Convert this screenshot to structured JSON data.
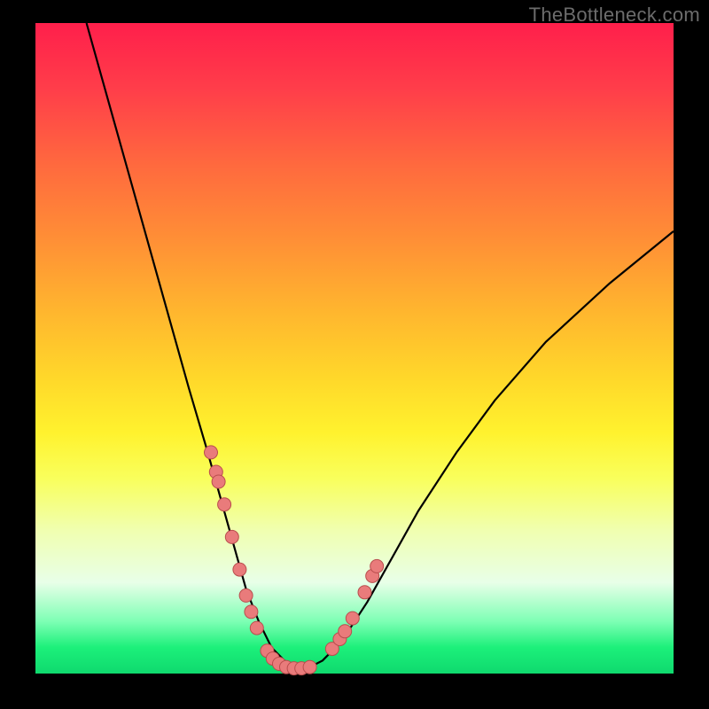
{
  "watermark": "TheBottleneck.com",
  "colors": {
    "background": "#000000",
    "curve": "#000000",
    "dot_fill": "#e97b7b",
    "dot_stroke": "#b94d4d"
  },
  "chart_data": {
    "type": "line",
    "title": "",
    "xlabel": "",
    "ylabel": "",
    "xlim": [
      0,
      100
    ],
    "ylim": [
      0,
      100
    ],
    "grid": false,
    "legend": false,
    "series": [
      {
        "name": "bottleneck-curve",
        "x": [
          8,
          12,
          16,
          20,
          24,
          27,
          29,
          31,
          33,
          35,
          37,
          39,
          41,
          43,
          45,
          48,
          52,
          56,
          60,
          66,
          72,
          80,
          90,
          100
        ],
        "y": [
          100,
          86,
          72,
          58,
          44,
          34,
          27,
          20,
          13,
          8,
          4,
          2,
          1,
          1,
          2,
          5,
          11,
          18,
          25,
          34,
          42,
          51,
          60,
          68
        ]
      }
    ],
    "markers": {
      "name": "sample-points",
      "x": [
        27.5,
        28.3,
        28.7,
        29.6,
        30.8,
        32.0,
        33.0,
        33.8,
        34.7,
        36.3,
        37.2,
        38.2,
        39.3,
        40.5,
        41.7,
        43.0,
        46.5,
        47.7,
        48.5,
        49.7,
        51.6,
        52.8,
        53.5
      ],
      "y": [
        34.0,
        31.0,
        29.5,
        26.0,
        21.0,
        16.0,
        12.0,
        9.5,
        7.0,
        3.5,
        2.3,
        1.5,
        1.0,
        0.8,
        0.8,
        1.0,
        3.8,
        5.3,
        6.5,
        8.5,
        12.5,
        15.0,
        16.5
      ]
    }
  }
}
